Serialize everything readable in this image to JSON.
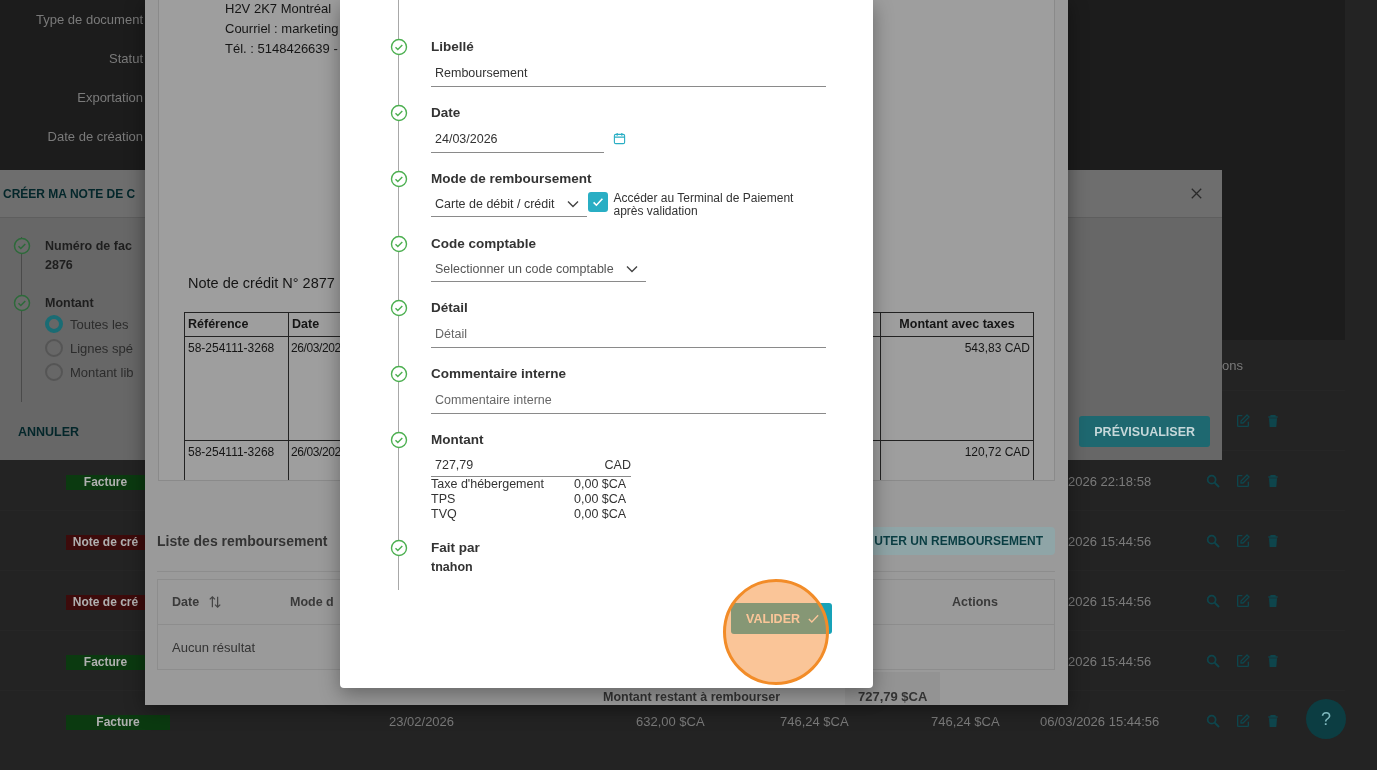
{
  "background_page": {
    "filter_labels": [
      "Type de document",
      "Statut",
      "Exportation",
      "Date de création"
    ],
    "table": {
      "header_partial": "ons",
      "rows": [
        {},
        {
          "badge": "Facture",
          "color": "#0b3a10",
          "created": "2026 22:18:58"
        },
        {
          "badge": "Note de cré",
          "color": "#3d0b0b",
          "created": "2026 15:44:56"
        },
        {
          "badge": "Note de cré",
          "color": "#3d0b0b",
          "created": "2026 15:44:56"
        },
        {
          "badge": "Facture",
          "color": "#0b3a10",
          "created": "2026 15:44:56"
        },
        {
          "badge": "Facture",
          "color": "#0b3a10",
          "issue_date": "23/02/2026",
          "amount": "632,00 $CA",
          "total": "746,24 $CA",
          "balance": "746,24 $CA",
          "created": "06/03/2026 15:44:56"
        }
      ]
    },
    "help_button": {
      "label": "?"
    }
  },
  "create_dialog": {
    "title": "CRÉER MA NOTE DE C",
    "steps": [
      {
        "label": "Numéro de fac",
        "value": "2876",
        "done": true
      },
      {
        "label": "Montant",
        "done": true,
        "options": [
          {
            "label": "Toutes les",
            "selected": true
          },
          {
            "label": "Lignes spé",
            "selected": false
          },
          {
            "label": "Montant lib",
            "selected": false
          }
        ]
      }
    ],
    "cancel": "ANNULER",
    "preview": "PRÉVISUALISER"
  },
  "preview_dialog": {
    "document": {
      "address_lines": [
        "H2V 2K7 Montréal",
        "Courriel : marketing",
        "Tél. : 5148426639 -"
      ],
      "title": "Note de crédit N° 2877",
      "table": {
        "left_columns": [
          "Référence",
          "Date"
        ],
        "right_column": "Montant avec taxes",
        "rows": [
          {
            "reference": "58-254111-3268",
            "date": "26/03/202",
            "total": "543,83 CAD"
          },
          {
            "reference": "58-254111-3268",
            "date": "26/03/202",
            "total": "120,72 CAD"
          }
        ]
      }
    },
    "refunds": {
      "title": "Liste des remboursement",
      "add_button": "UTER UN REMBOURSEMENT",
      "columns": [
        "Date",
        "Mode d",
        "Actions"
      ],
      "empty": "Aucun résultat",
      "remaining_label": "Montant restant à rembourser",
      "remaining_value": "727,79 $CA"
    }
  },
  "refund_form": {
    "steps": [
      {
        "kind": "text",
        "label": "Libellé",
        "value": "Remboursement",
        "done": true
      },
      {
        "kind": "date",
        "label": "Date",
        "value": "24/03/2026",
        "done": true
      },
      {
        "kind": "select",
        "label": "Mode de remboursement",
        "value": "Carte de débit / crédit",
        "done": true,
        "checkbox": {
          "label": "Accéder au Terminal de Paiement après validation",
          "checked": true
        }
      },
      {
        "kind": "select",
        "label": "Code comptable",
        "placeholder": "Selectionner un code comptable",
        "done": true
      },
      {
        "kind": "text",
        "label": "Détail",
        "placeholder": "Détail",
        "done": true
      },
      {
        "kind": "text",
        "label": "Commentaire interne",
        "placeholder": "Commentaire interne",
        "done": true
      },
      {
        "kind": "amount",
        "label": "Montant",
        "value": "727,79",
        "currency": "CAD",
        "done": true,
        "taxes": [
          {
            "name": "Taxe d'hébergement",
            "amount": "0,00 $CA"
          },
          {
            "name": "TPS",
            "amount": "0,00 $CA"
          },
          {
            "name": "TVQ",
            "amount": "0,00 $CA"
          }
        ]
      },
      {
        "kind": "readonly",
        "label": "Fait par",
        "value": "tnahon",
        "done": true
      }
    ],
    "submit": "VALIDER"
  }
}
